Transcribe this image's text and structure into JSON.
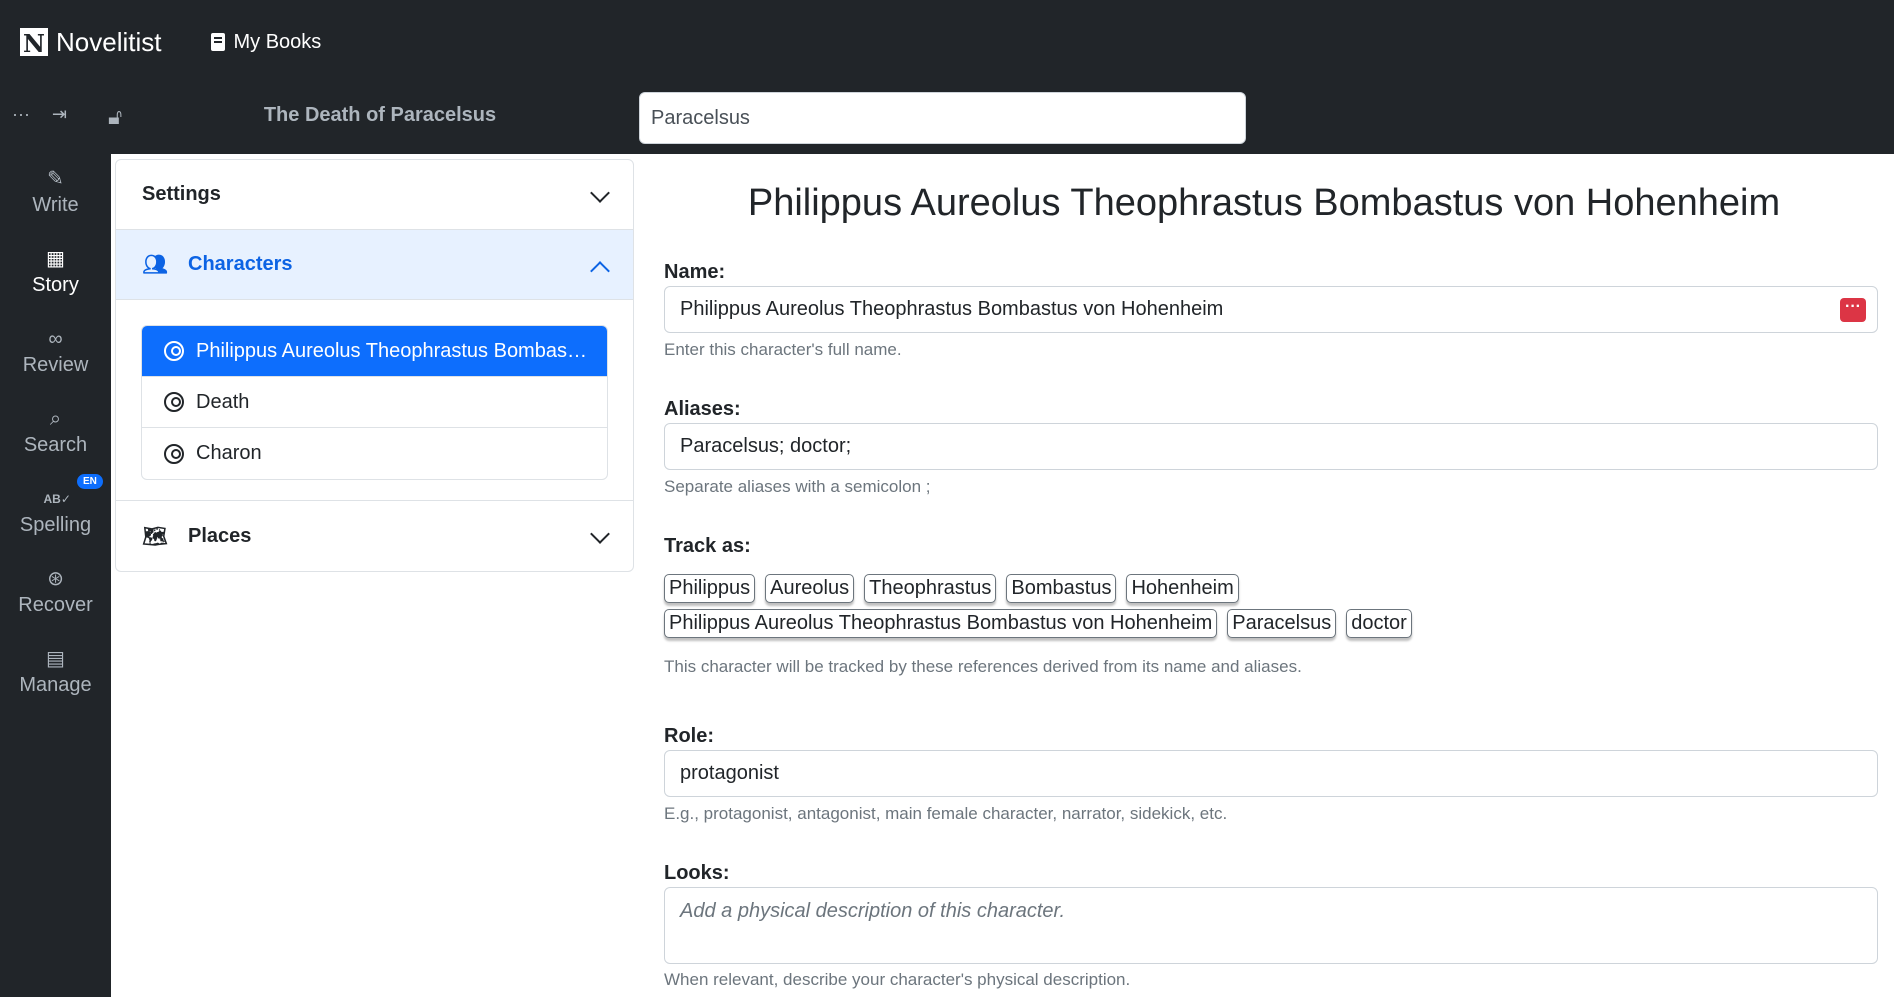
{
  "app": {
    "brand": "Novelitist",
    "nav_my_books": "My Books"
  },
  "toolbar": {
    "more_icon": "ellipsis-icon",
    "pin_icon": "pin-icon",
    "lock_icon": "unlock-icon",
    "book_title": "The Death of Paracelsus",
    "search_value": "Paracelsus"
  },
  "rail": {
    "items": [
      {
        "label": "Write",
        "icon": "feather-icon"
      },
      {
        "label": "Story",
        "icon": "story-icon",
        "active": true
      },
      {
        "label": "Review",
        "icon": "glasses-icon"
      },
      {
        "label": "Search",
        "icon": "search-icon"
      },
      {
        "label": "Spelling",
        "icon": "spellcheck-icon",
        "badge": "EN"
      },
      {
        "label": "Recover",
        "icon": "lifebuoy-icon"
      },
      {
        "label": "Manage",
        "icon": "book-icon"
      }
    ]
  },
  "accordion": {
    "settings": "Settings",
    "characters": "Characters",
    "places": "Places",
    "character_list": [
      "Philippus Aureolus Theophrastus Bombastus von Hohenheim",
      "Death",
      "Charon"
    ]
  },
  "character": {
    "title": "Philippus Aureolus Theophrastus Bombastus von Hohenheim",
    "name_label": "Name:",
    "name_value": "Philippus Aureolus Theophrastus Bombastus von Hohenheim",
    "name_help": "Enter this character's full name.",
    "aliases_label": "Aliases:",
    "aliases_value": "Paracelsus; doctor;",
    "aliases_help": "Separate aliases with a semicolon ;",
    "track_label": "Track as:",
    "track_tags": [
      "Philippus",
      "Aureolus",
      "Theophrastus",
      "Bombastus",
      "Hohenheim",
      "Philippus Aureolus Theophrastus Bombastus von Hohenheim",
      "Paracelsus",
      "doctor"
    ],
    "track_help": "This character will be tracked by these references derived from its name and aliases.",
    "role_label": "Role:",
    "role_value": "protagonist",
    "role_help": "E.g., protagonist, antagonist, main female character, narrator, sidekick, etc.",
    "looks_label": "Looks:",
    "looks_placeholder": "Add a physical description of this character.",
    "looks_help": "When relevant, describe your character's physical description."
  },
  "colors": {
    "dark": "#212529",
    "primary": "#0d6efd",
    "danger": "#dc3545"
  }
}
